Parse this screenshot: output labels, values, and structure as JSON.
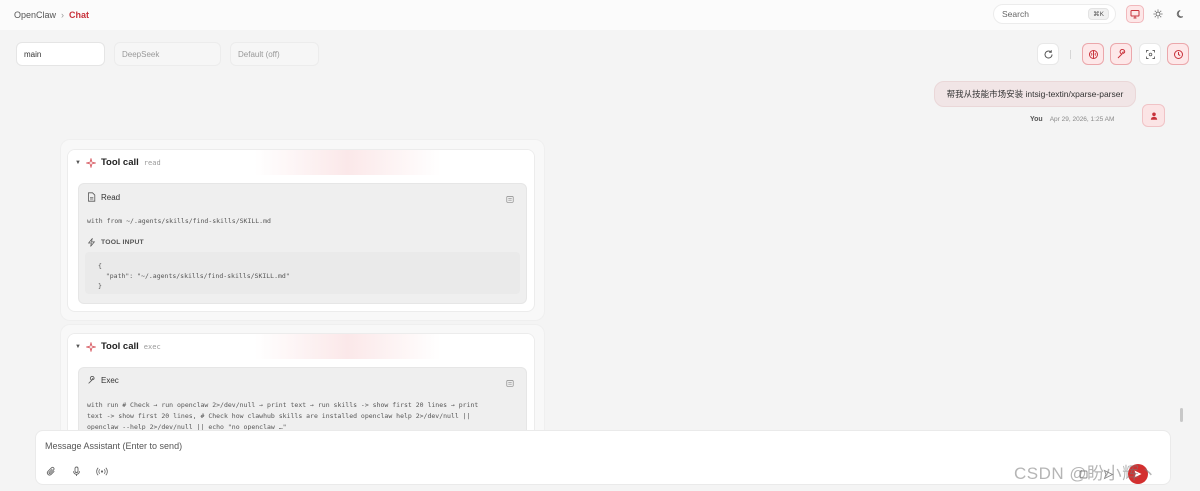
{
  "breadcrumb": {
    "app": "OpenClaw",
    "separator": "›",
    "current": "Chat"
  },
  "search": {
    "placeholder": "Search",
    "shortcut": "⌘K"
  },
  "theme": {
    "modes": [
      "system",
      "light",
      "dark"
    ],
    "active": "system"
  },
  "session": {
    "fields": [
      {
        "value": "main"
      },
      {
        "value": "DeepSeek"
      },
      {
        "value": "Default (off)"
      }
    ],
    "controls": [
      "refresh-icon",
      "brain-icon",
      "wrench-icon",
      "focus-icon",
      "clock-icon"
    ]
  },
  "user_message": {
    "text": "帮我从技能市场安装 intsig-textin/xparse-parser",
    "author": "You",
    "timestamp": "Apr 29, 2026, 1:25 AM"
  },
  "tool_calls": [
    {
      "title": "Tool call",
      "tool": "read",
      "action_label": "Read",
      "description": "with from ~/.agents/skills/find-skills/SKILL.md",
      "input_label": "TOOL INPUT",
      "input_lines": [
        "{",
        "  \"path\": \"~/.agents/skills/find-skills/SKILL.md\"",
        "}"
      ]
    },
    {
      "title": "Tool call",
      "tool": "exec",
      "action_label": "Exec",
      "description_lines": [
        "with run # Check → run openclaw 2>/dev/null → print text → run skills -> show first 20 lines → print",
        "text -> show first 20 lines, # Check how clawhub skills are installed openclaw help 2>/dev/null ||",
        "openclaw --help 2>/dev/null || echo \"no openclaw …\""
      ]
    }
  ],
  "composer": {
    "placeholder": "Message Assistant (Enter to send)"
  },
  "watermark": "CSDN @盼小辉丶",
  "colors": {
    "accent": "#c8323b",
    "send": "#d32f2f"
  }
}
